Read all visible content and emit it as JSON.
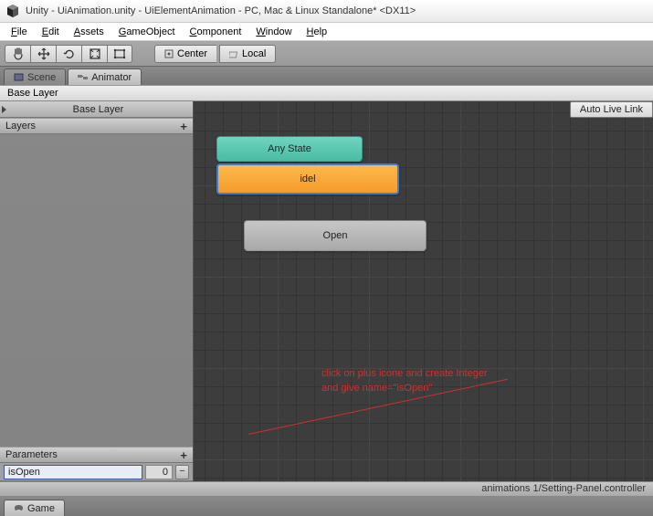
{
  "title": "Unity - UiAnimation.unity - UiElementAnimation - PC, Mac & Linux Standalone* <DX11>",
  "menu": {
    "file": "File",
    "edit": "Edit",
    "assets": "Assets",
    "gameobject": "GameObject",
    "component": "Component",
    "window": "Window",
    "help": "Help"
  },
  "toolbar": {
    "center": "Center",
    "local": "Local"
  },
  "tabs": {
    "scene": "Scene",
    "animator": "Animator",
    "game": "Game"
  },
  "layer_header": "Base Layer",
  "sidebar": {
    "current_layer": "Base Layer",
    "layers_label": "Layers",
    "parameters_label": "Parameters",
    "param_name": "isOpen",
    "param_value": "0"
  },
  "graph": {
    "auto_live_link": "Auto Live Link",
    "nodes": {
      "any": "Any State",
      "idel": "idel",
      "open": "Open"
    }
  },
  "annotation": {
    "line1": "click on plus icone and create Integer",
    "line2": "and give name=\"isOpen\""
  },
  "footer": "animations 1/Setting-Panel.controller"
}
